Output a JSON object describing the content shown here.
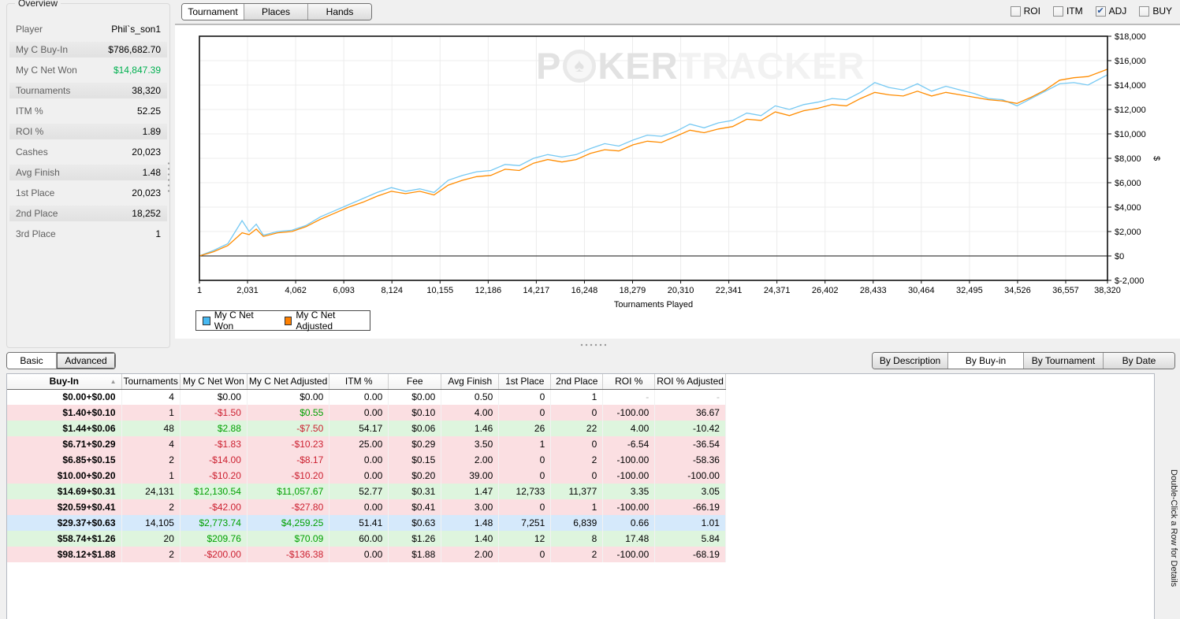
{
  "sidebar": {
    "title": "Overview",
    "rows": [
      {
        "label": "Player",
        "value": "Phil`s_son1",
        "shaded": false
      },
      {
        "label": "My C Buy-In",
        "value": "$786,682.70",
        "shaded": true
      },
      {
        "label": "My C Net Won",
        "value": "$14,847.39",
        "shaded": false,
        "value_color": "#00b050"
      },
      {
        "label": "Tournaments",
        "value": "38,320",
        "shaded": true
      },
      {
        "label": "ITM %",
        "value": "52.25",
        "shaded": false
      },
      {
        "label": "ROI %",
        "value": "1.89",
        "shaded": true
      },
      {
        "label": "Cashes",
        "value": "20,023",
        "shaded": false
      },
      {
        "label": "Avg Finish",
        "value": "1.48",
        "shaded": true
      },
      {
        "label": "1st Place",
        "value": "20,023",
        "shaded": false
      },
      {
        "label": "2nd Place",
        "value": "18,252",
        "shaded": true
      },
      {
        "label": "3rd Place",
        "value": "1",
        "shaded": false
      }
    ]
  },
  "top_tabs": [
    {
      "label": "Tournament",
      "active": true,
      "width": 78
    },
    {
      "label": "Places",
      "active": false,
      "width": 80
    },
    {
      "label": "Hands",
      "active": false,
      "width": 80
    }
  ],
  "checkboxes": [
    {
      "label": "ROI",
      "checked": false
    },
    {
      "label": "ITM",
      "checked": false
    },
    {
      "label": "ADJ",
      "checked": true
    },
    {
      "label": "BUY",
      "checked": false
    }
  ],
  "watermark": {
    "part1": "P",
    "chip": "♠",
    "part2": "KER",
    "part3": "TRACKER"
  },
  "chart_data": {
    "type": "line",
    "xlabel": "Tournaments Played",
    "ylabel": "$",
    "xlim": [
      1,
      38320
    ],
    "ylim": [
      -2000,
      18000
    ],
    "grid": true,
    "legend_position": "bottom-left",
    "x_ticks": [
      [
        1,
        "1"
      ],
      [
        2031,
        "2,031"
      ],
      [
        4062,
        "4,062"
      ],
      [
        6093,
        "6,093"
      ],
      [
        8124,
        "8,124"
      ],
      [
        10155,
        "10,155"
      ],
      [
        12186,
        "12,186"
      ],
      [
        14217,
        "14,217"
      ],
      [
        16248,
        "16,248"
      ],
      [
        18279,
        "18,279"
      ],
      [
        20310,
        "20,310"
      ],
      [
        22341,
        "22,341"
      ],
      [
        24371,
        "24,371"
      ],
      [
        26402,
        "26,402"
      ],
      [
        28433,
        "28,433"
      ],
      [
        30464,
        "30,464"
      ],
      [
        32495,
        "32,495"
      ],
      [
        34526,
        "34,526"
      ],
      [
        36557,
        "36,557"
      ],
      [
        38320,
        "38,320"
      ]
    ],
    "y_ticks": [
      [
        -2000,
        "$-2,000"
      ],
      [
        0,
        "$0"
      ],
      [
        2000,
        "$2,000"
      ],
      [
        4000,
        "$4,000"
      ],
      [
        6000,
        "$6,000"
      ],
      [
        8000,
        "$8,000"
      ],
      [
        10000,
        "$10,000"
      ],
      [
        12000,
        "$12,000"
      ],
      [
        14000,
        "$14,000"
      ],
      [
        16000,
        "$16,000"
      ],
      [
        18000,
        "$18,000"
      ]
    ],
    "x": [
      1,
      600,
      1200,
      1800,
      2100,
      2400,
      2700,
      3300,
      3900,
      4500,
      5100,
      5700,
      6300,
      6900,
      7500,
      8100,
      8700,
      9300,
      9900,
      10500,
      11100,
      11700,
      12300,
      12900,
      13500,
      14100,
      14700,
      15300,
      15900,
      16500,
      17100,
      17700,
      18300,
      18900,
      19500,
      20100,
      20700,
      21300,
      21900,
      22500,
      23100,
      23700,
      24300,
      24900,
      25500,
      26100,
      26700,
      27300,
      27900,
      28500,
      29100,
      29700,
      30300,
      30900,
      31500,
      32100,
      32700,
      33300,
      33900,
      34500,
      35100,
      35700,
      36300,
      36900,
      37500,
      38320
    ],
    "series": [
      {
        "name": "My C Net Won",
        "color": "#76c9f3",
        "values": [
          0,
          450,
          1000,
          2900,
          2000,
          2600,
          1700,
          2000,
          2100,
          2500,
          3200,
          3700,
          4200,
          4700,
          5200,
          5600,
          5300,
          5500,
          5200,
          6200,
          6600,
          6900,
          7000,
          7500,
          7400,
          8000,
          8300,
          8100,
          8300,
          8800,
          9200,
          9000,
          9500,
          9900,
          9800,
          10200,
          10800,
          10500,
          10900,
          11100,
          11700,
          11500,
          12300,
          12000,
          12400,
          12600,
          12900,
          12800,
          13400,
          14200,
          13800,
          13600,
          14100,
          13500,
          13900,
          13600,
          13300,
          12900,
          12800,
          12300,
          12900,
          13500,
          14100,
          14200,
          14000,
          14847
        ]
      },
      {
        "name": "My C Net Adjusted",
        "color": "#ff8c00",
        "values": [
          0,
          350,
          850,
          1900,
          1750,
          2200,
          1600,
          1900,
          2000,
          2400,
          3000,
          3500,
          4000,
          4400,
          4900,
          5300,
          5100,
          5300,
          5000,
          5800,
          6200,
          6500,
          6600,
          7100,
          7000,
          7600,
          7900,
          7700,
          7900,
          8400,
          8700,
          8600,
          9100,
          9400,
          9300,
          9800,
          10300,
          10100,
          10400,
          10600,
          11200,
          11100,
          11800,
          11500,
          11900,
          12100,
          12400,
          12300,
          12900,
          13400,
          13200,
          13100,
          13500,
          13100,
          13400,
          13200,
          13000,
          12800,
          12700,
          12500,
          13000,
          13600,
          14400,
          14600,
          14700,
          15300
        ]
      }
    ]
  },
  "legend": [
    {
      "label": "My C Net Won",
      "color": "#47b9f2"
    },
    {
      "label": "My C Net Adjusted",
      "color": "#ff8000"
    }
  ],
  "bottom_tabs": [
    {
      "label": "Basic",
      "active": true,
      "focused": false,
      "width": 62
    },
    {
      "label": "Advanced",
      "active": false,
      "focused": true,
      "width": 74
    }
  ],
  "group_buttons": [
    {
      "label": "By Description",
      "active": false,
      "width": 95
    },
    {
      "label": "By Buy-in",
      "active": true,
      "width": 95
    },
    {
      "label": "By Tournament",
      "active": false,
      "width": 100
    },
    {
      "label": "By Date",
      "active": false,
      "width": 90
    }
  ],
  "table": {
    "columns": [
      {
        "label": "Buy-In",
        "width": 145,
        "bold": true,
        "sort": "asc"
      },
      {
        "label": "Tournaments",
        "width": 68
      },
      {
        "label": "My C Net Won",
        "width": 85
      },
      {
        "label": "My C Net Adjusted",
        "width": 86
      },
      {
        "label": "ITM %",
        "width": 75
      },
      {
        "label": "Fee",
        "width": 67
      },
      {
        "label": "Avg Finish",
        "width": 73
      },
      {
        "label": "1st Place",
        "width": 66
      },
      {
        "label": "2nd Place",
        "width": 66
      },
      {
        "label": "ROI %",
        "width": 66
      },
      {
        "label": "ROI % Adjusted",
        "width": 84
      }
    ],
    "rows": [
      {
        "bg": "w",
        "cells": [
          [
            "$0.00+$0.00"
          ],
          [
            "4"
          ],
          [
            "$0.00"
          ],
          [
            "$0.00"
          ],
          [
            "0.00"
          ],
          [
            "$0.00"
          ],
          [
            "0.50"
          ],
          [
            "0"
          ],
          [
            "1"
          ],
          [
            "-",
            "d"
          ],
          [
            "-",
            "d"
          ]
        ]
      },
      {
        "bg": "p",
        "cells": [
          [
            "$1.40+$0.10"
          ],
          [
            "1"
          ],
          [
            "-$1.50",
            "n"
          ],
          [
            "$0.55",
            "p"
          ],
          [
            "0.00"
          ],
          [
            "$0.10"
          ],
          [
            "4.00"
          ],
          [
            "0"
          ],
          [
            "0"
          ],
          [
            "-100.00"
          ],
          [
            "36.67"
          ]
        ]
      },
      {
        "bg": "g",
        "cells": [
          [
            "$1.44+$0.06"
          ],
          [
            "48"
          ],
          [
            "$2.88",
            "p"
          ],
          [
            "-$7.50",
            "n"
          ],
          [
            "54.17"
          ],
          [
            "$0.06"
          ],
          [
            "1.46"
          ],
          [
            "26"
          ],
          [
            "22"
          ],
          [
            "4.00"
          ],
          [
            "-10.42"
          ]
        ]
      },
      {
        "bg": "p",
        "cells": [
          [
            "$6.71+$0.29"
          ],
          [
            "4"
          ],
          [
            "-$1.83",
            "n"
          ],
          [
            "-$10.23",
            "n"
          ],
          [
            "25.00"
          ],
          [
            "$0.29"
          ],
          [
            "3.50"
          ],
          [
            "1"
          ],
          [
            "0"
          ],
          [
            "-6.54"
          ],
          [
            "-36.54"
          ]
        ]
      },
      {
        "bg": "p",
        "cells": [
          [
            "$6.85+$0.15"
          ],
          [
            "2"
          ],
          [
            "-$14.00",
            "n"
          ],
          [
            "-$8.17",
            "n"
          ],
          [
            "0.00"
          ],
          [
            "$0.15"
          ],
          [
            "2.00"
          ],
          [
            "0"
          ],
          [
            "2"
          ],
          [
            "-100.00"
          ],
          [
            "-58.36"
          ]
        ]
      },
      {
        "bg": "p",
        "cells": [
          [
            "$10.00+$0.20"
          ],
          [
            "1"
          ],
          [
            "-$10.20",
            "n"
          ],
          [
            "-$10.20",
            "n"
          ],
          [
            "0.00"
          ],
          [
            "$0.20"
          ],
          [
            "39.00"
          ],
          [
            "0"
          ],
          [
            "0"
          ],
          [
            "-100.00"
          ],
          [
            "-100.00"
          ]
        ]
      },
      {
        "bg": "g",
        "cells": [
          [
            "$14.69+$0.31"
          ],
          [
            "24,131"
          ],
          [
            "$12,130.54",
            "p"
          ],
          [
            "$11,057.67",
            "p"
          ],
          [
            "52.77"
          ],
          [
            "$0.31"
          ],
          [
            "1.47"
          ],
          [
            "12,733"
          ],
          [
            "11,377"
          ],
          [
            "3.35"
          ],
          [
            "3.05"
          ]
        ]
      },
      {
        "bg": "p",
        "cells": [
          [
            "$20.59+$0.41"
          ],
          [
            "2"
          ],
          [
            "-$42.00",
            "n"
          ],
          [
            "-$27.80",
            "n"
          ],
          [
            "0.00"
          ],
          [
            "$0.41"
          ],
          [
            "3.00"
          ],
          [
            "0"
          ],
          [
            "1"
          ],
          [
            "-100.00"
          ],
          [
            "-66.19"
          ]
        ]
      },
      {
        "bg": "s",
        "cells": [
          [
            "$29.37+$0.63"
          ],
          [
            "14,105"
          ],
          [
            "$2,773.74",
            "p"
          ],
          [
            "$4,259.25",
            "p"
          ],
          [
            "51.41"
          ],
          [
            "$0.63"
          ],
          [
            "1.48"
          ],
          [
            "7,251"
          ],
          [
            "6,839"
          ],
          [
            "0.66"
          ],
          [
            "1.01"
          ]
        ]
      },
      {
        "bg": "g",
        "cells": [
          [
            "$58.74+$1.26"
          ],
          [
            "20"
          ],
          [
            "$209.76",
            "p"
          ],
          [
            "$70.09",
            "p"
          ],
          [
            "60.00"
          ],
          [
            "$1.26"
          ],
          [
            "1.40"
          ],
          [
            "12"
          ],
          [
            "8"
          ],
          [
            "17.48"
          ],
          [
            "5.84"
          ]
        ]
      },
      {
        "bg": "p",
        "cells": [
          [
            "$98.12+$1.88"
          ],
          [
            "2"
          ],
          [
            "-$200.00",
            "n"
          ],
          [
            "-$136.38",
            "n"
          ],
          [
            "0.00"
          ],
          [
            "$1.88"
          ],
          [
            "2.00"
          ],
          [
            "0"
          ],
          [
            "2"
          ],
          [
            "-100.00"
          ],
          [
            "-68.19"
          ]
        ]
      }
    ]
  },
  "side_note": "Double-Click a Row for Details"
}
